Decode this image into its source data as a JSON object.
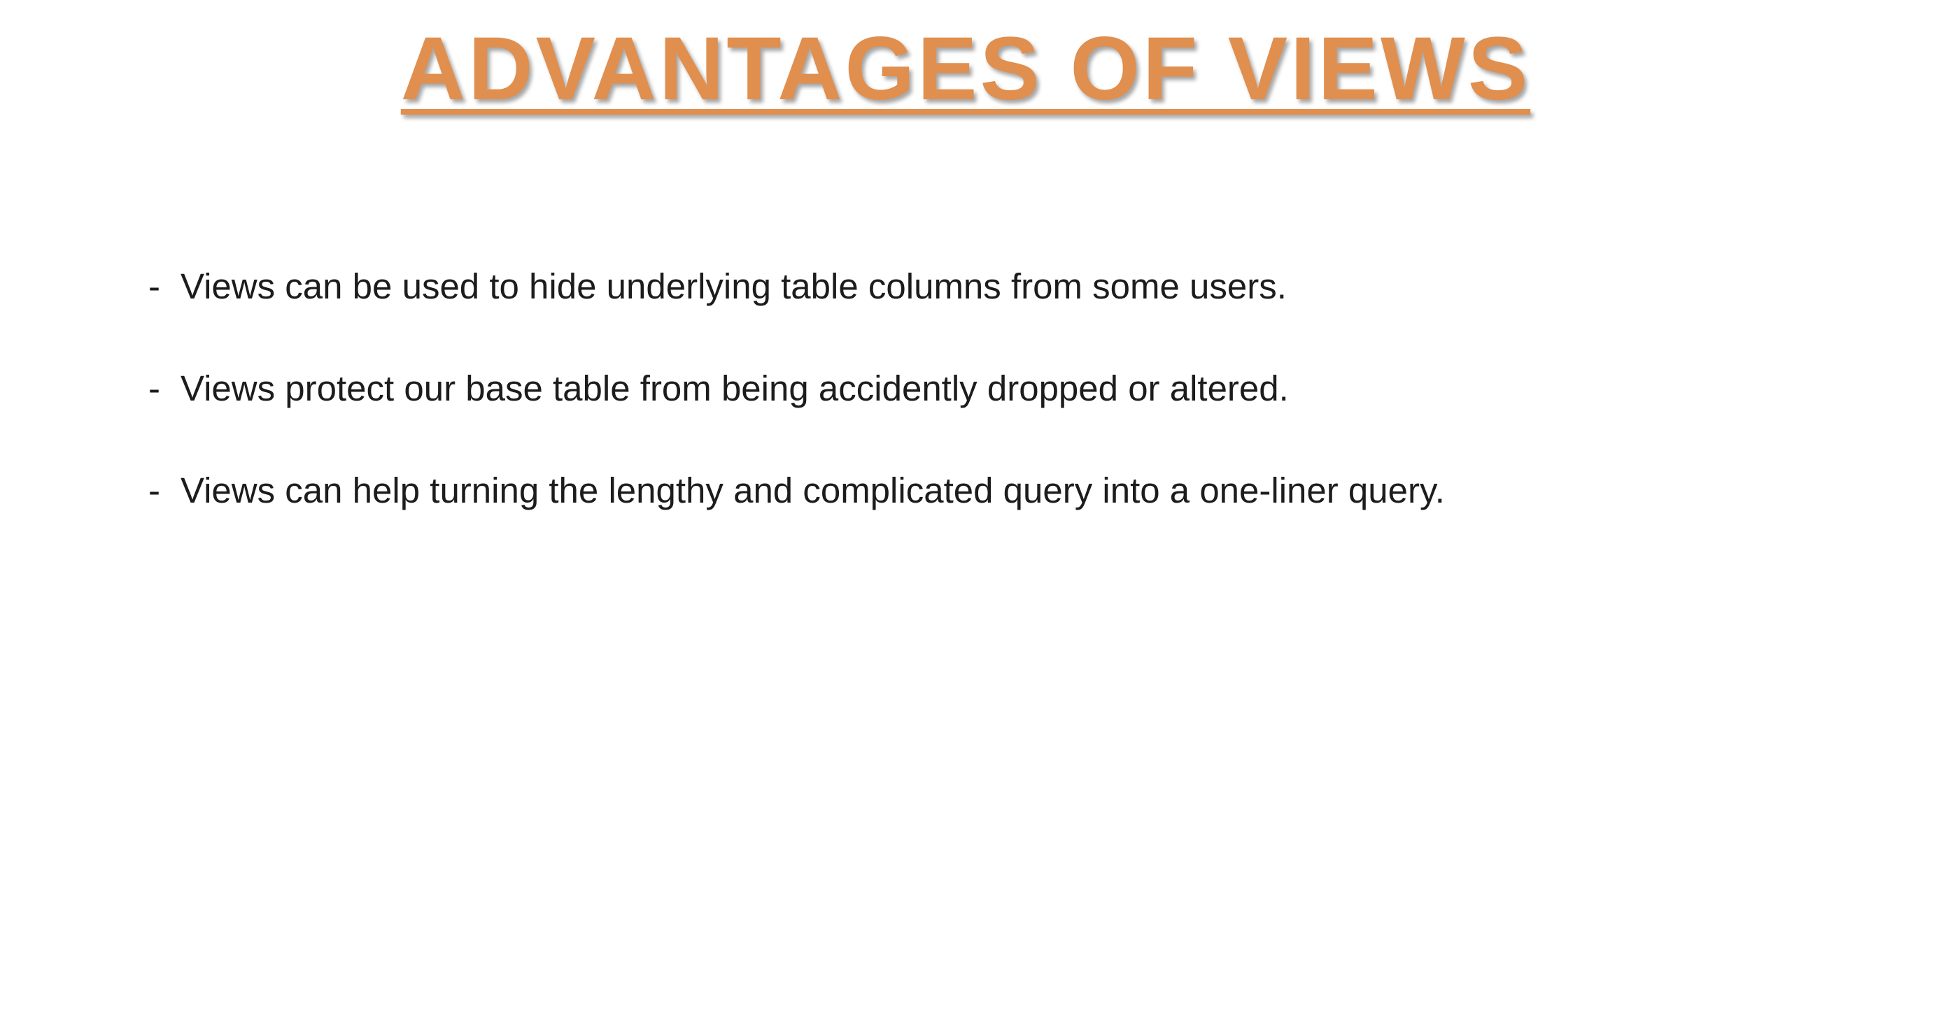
{
  "slide": {
    "title": "ADVANTAGES OF VIEWS",
    "bullet_marker": "-",
    "bullets": [
      "Views can be used to hide underlying table columns from some users.",
      "Views protect our base table from being accidently dropped or altered.",
      "Views can help turning the lengthy and complicated query into a one-liner query."
    ]
  },
  "colors": {
    "title": "#e08f4f",
    "body_text": "#1c1c1c",
    "background": "#ffffff"
  }
}
